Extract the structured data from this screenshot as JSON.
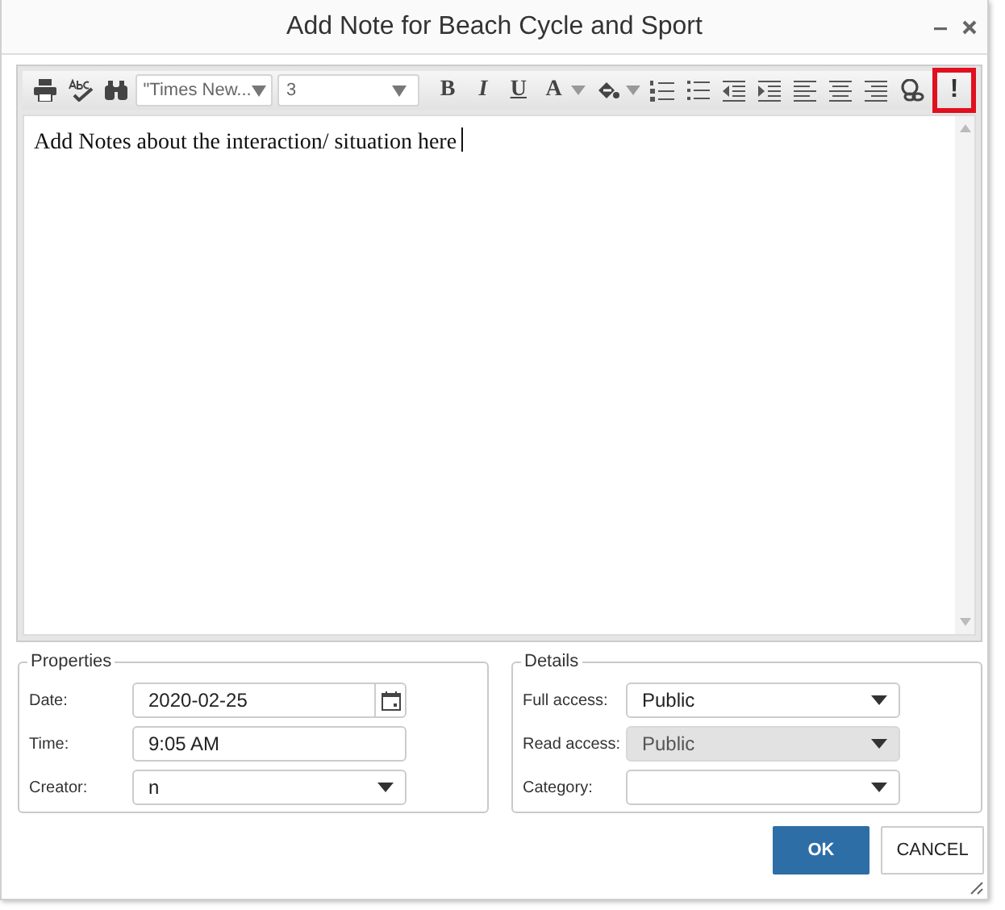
{
  "window": {
    "title": "Add Note for Beach Cycle and Sport"
  },
  "toolbar": [
    {
      "kind": "print",
      "highlighted": false
    },
    {
      "kind": "spellcheck",
      "highlighted": false
    },
    {
      "kind": "find",
      "highlighted": false
    },
    {
      "kind": "font",
      "label": "\"Times New...",
      "highlighted": false
    },
    {
      "kind": "size",
      "label": "3",
      "highlighted": false
    },
    {
      "kind": "bold",
      "label": "B",
      "highlighted": false
    },
    {
      "kind": "italic",
      "label": "I",
      "highlighted": false
    },
    {
      "kind": "underline",
      "label": "U",
      "highlighted": false
    },
    {
      "kind": "color",
      "label": "A",
      "highlighted": false
    },
    {
      "kind": "fill",
      "highlighted": false
    },
    {
      "kind": "ordered",
      "highlighted": false
    },
    {
      "kind": "bullets",
      "highlighted": false
    },
    {
      "kind": "outdent",
      "highlighted": false
    },
    {
      "kind": "indent",
      "highlighted": false
    },
    {
      "kind": "left",
      "highlighted": false
    },
    {
      "kind": "center",
      "highlighted": false
    },
    {
      "kind": "right",
      "highlighted": false
    },
    {
      "kind": "link",
      "highlighted": false
    },
    {
      "kind": "important",
      "label": "!",
      "highlighted": true
    }
  ],
  "editor": {
    "text": "Add Notes about the interaction/ situation here"
  },
  "properties": {
    "legend": "Properties",
    "fields": [
      {
        "label": "Date:",
        "kind": "date",
        "value": "2020-02-25",
        "disabled": false
      },
      {
        "label": "Time:",
        "kind": "text",
        "value": "9:05 AM",
        "disabled": false
      },
      {
        "label": "Creator:",
        "kind": "select",
        "value": "n",
        "disabled": false
      }
    ]
  },
  "details": {
    "legend": "Details",
    "fields": [
      {
        "label": "Full access:",
        "kind": "select",
        "value": "Public",
        "disabled": false
      },
      {
        "label": "Read access:",
        "kind": "select",
        "value": "Public",
        "disabled": true
      },
      {
        "label": "Category:",
        "kind": "select",
        "disabled": false
      }
    ]
  },
  "buttons": [
    {
      "label": "OK",
      "kind": "primary"
    },
    {
      "label": "CANCEL",
      "kind": "secondary"
    }
  ]
}
